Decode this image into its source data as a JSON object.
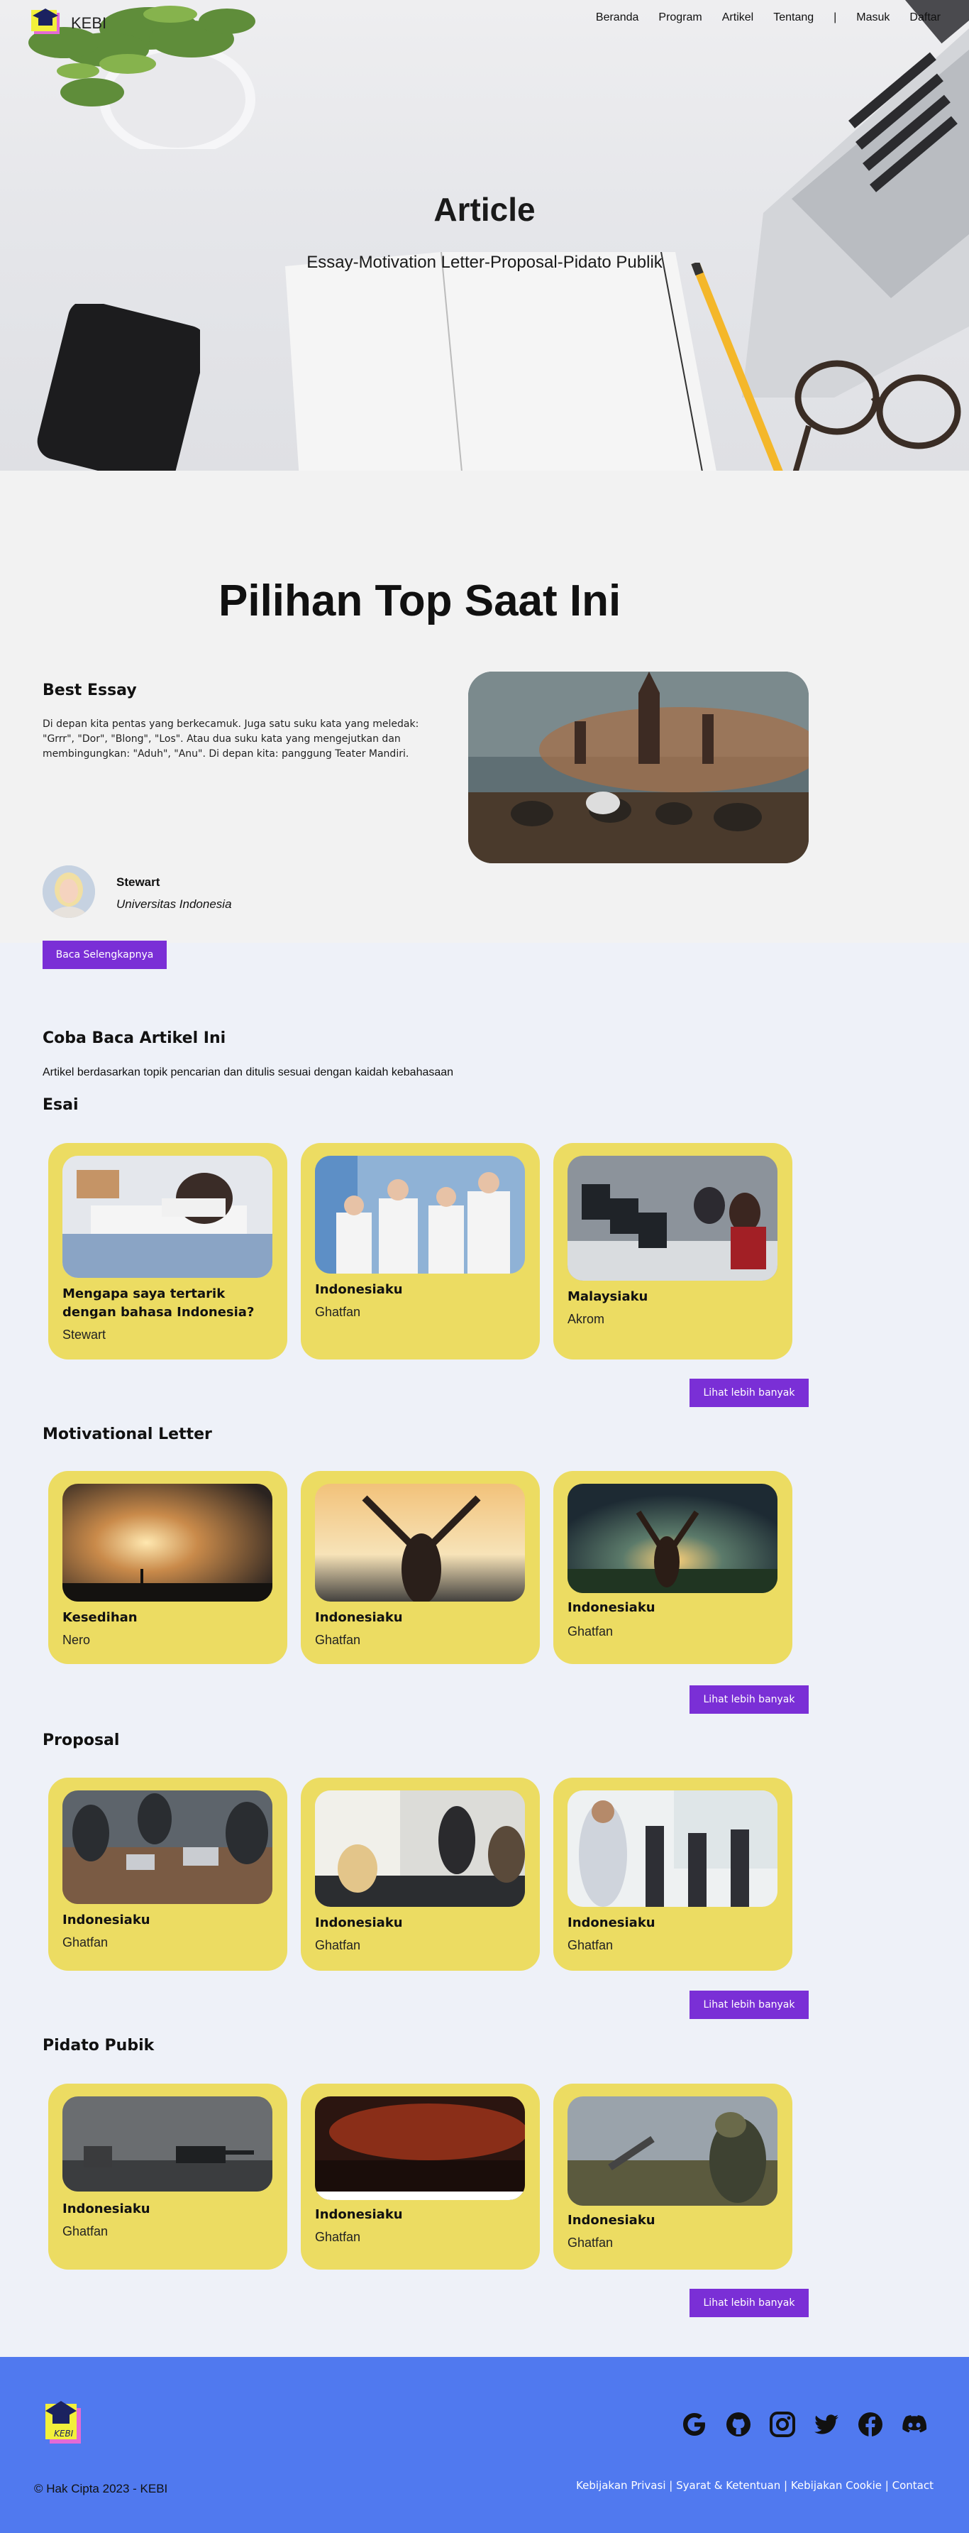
{
  "nav": {
    "brand": "KEBI",
    "links": [
      "Beranda",
      "Program",
      "Artikel",
      "Tentang",
      "|",
      "Masuk",
      "Daftar"
    ]
  },
  "hero": {
    "title": "Article",
    "subtitle": "Essay-Motivation Letter-Proposal-Pidato Publik"
  },
  "top": {
    "title": "Pilihan Top Saat Ini",
    "label": "Best Essay",
    "text": "Di depan kita pentas yang berkecamuk. Juga satu suku kata yang meledak: \"Grrr\", \"Dor\", \"Blong\", \"Los\". Atau dua suku kata yang mengejutkan dan membingungkan: \"Aduh\", \"Anu\". Di depan kita: panggung Teater Mandiri.",
    "author": "Stewart",
    "university": "Universitas Indonesia",
    "button": "Baca Selengkapnya"
  },
  "articles": {
    "title": "Coba Baca Artikel Ini",
    "description": "Artikel berdasarkan topik pencarian dan ditulis sesuai dengan kaidah kebahasaan",
    "view_more": "Lihat lebih banyak",
    "categories": [
      {
        "name": "Esai",
        "cards": [
          {
            "title": "Mengapa saya tertarik dengan bahasa Indonesia?",
            "author": "Stewart"
          },
          {
            "title": "Indonesiaku",
            "author": "Ghatfan"
          },
          {
            "title": "Malaysiaku",
            "author": "Akrom"
          }
        ]
      },
      {
        "name": "Motivational Letter",
        "cards": [
          {
            "title": "Kesedihan",
            "author": "Nero"
          },
          {
            "title": "Indonesiaku",
            "author": "Ghatfan"
          },
          {
            "title": "Indonesiaku",
            "author": "Ghatfan"
          }
        ]
      },
      {
        "name": "Proposal",
        "cards": [
          {
            "title": "Indonesiaku",
            "author": "Ghatfan"
          },
          {
            "title": "Indonesiaku",
            "author": "Ghatfan"
          },
          {
            "title": "Indonesiaku",
            "author": "Ghatfan"
          }
        ]
      },
      {
        "name": "Pidato Pubik",
        "cards": [
          {
            "title": "Indonesiaku",
            "author": "Ghatfan"
          },
          {
            "title": "Indonesiaku",
            "author": "Ghatfan"
          },
          {
            "title": "Indonesiaku",
            "author": "Ghatfan"
          }
        ]
      }
    ]
  },
  "footer": {
    "copyright": "© Hak Cipta 2023 - KEBI",
    "logo_text": "KEBI",
    "links": [
      "Kebijakan Privasi",
      "|",
      "Syarat & Ketentuan",
      "|",
      "Kebijakan Cookie",
      "|",
      "Contact"
    ],
    "social_icons": [
      "google-icon",
      "github-icon",
      "instagram-icon",
      "twitter-icon",
      "facebook-icon",
      "discord-icon"
    ]
  },
  "colors": {
    "accent": "#7a2fd6",
    "card": "#ecdc62",
    "footer": "#5079ef",
    "top_bg": "#f2f2f2",
    "page_bg": "#eef1f8"
  }
}
